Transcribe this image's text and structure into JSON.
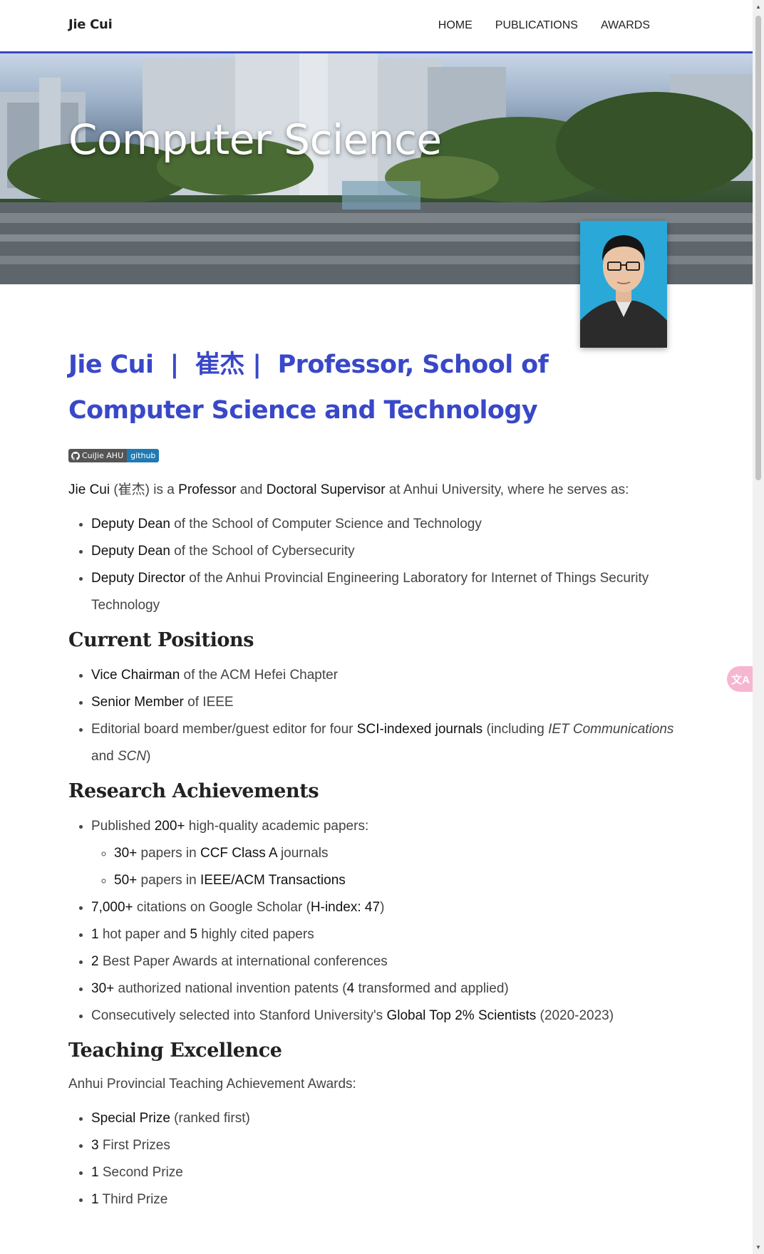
{
  "nav": {
    "brand": "Jie Cui",
    "items": [
      "HOME",
      "PUBLICATIONS",
      "AWARDS"
    ]
  },
  "hero": {
    "title": "Computer Science"
  },
  "profile": {
    "title": "Jie Cui  |  崔杰 |  Professor, School of Computer Science and Technology",
    "badge_left": "CuiJie AHU",
    "badge_right": "github"
  },
  "intro": {
    "name": "Jie Cui",
    "cn": "(崔杰)",
    "t1": " is a ",
    "role1": "Professor",
    "t2": " and ",
    "role2": "Doctoral Supervisor",
    "t3": " at Anhui University, where he serves as:"
  },
  "roles": [
    {
      "strong": "Deputy Dean",
      "rest": " of the School of Computer Science and Technology"
    },
    {
      "strong": "Deputy Dean",
      "rest": " of the School of Cybersecurity"
    },
    {
      "strong": "Deputy Director",
      "rest": " of the Anhui Provincial Engineering Laboratory for Internet of Things Security Technology"
    }
  ],
  "positions": {
    "heading": "Current Positions",
    "items": [
      {
        "strong": "Vice Chairman",
        "rest": " of the ACM Hefei Chapter"
      },
      {
        "strong": "Senior Member",
        "rest": " of IEEE"
      }
    ],
    "editorial": {
      "pre": "Editorial board member/guest editor for four ",
      "strong": "SCI-indexed journals",
      "mid": " (including ",
      "j1": "IET Communications",
      "and": " and ",
      "j2": "SCN",
      "end": ")"
    }
  },
  "research": {
    "heading": "Research Achievements",
    "papers": {
      "pre": "Published ",
      "strong": "200+",
      "rest": " high-quality academic papers:"
    },
    "sub": [
      {
        "num": "30+",
        "mid": " papers in ",
        "strong": "CCF Class A",
        "rest": " journals"
      },
      {
        "num": "50+",
        "mid": " papers in ",
        "strong": "IEEE/ACM Transactions",
        "rest": ""
      }
    ],
    "citations": {
      "num": "7,000+",
      "mid": " citations on Google Scholar (",
      "strong": "H-index: 47",
      "end": ")"
    },
    "hot": {
      "n1": "1",
      "t1": " hot paper and ",
      "n2": "5",
      "t2": " highly cited papers"
    },
    "best": {
      "n": "2",
      "t": " Best Paper Awards at international conferences"
    },
    "patents": {
      "n": "30+",
      "t1": " authorized national invention patents (",
      "n2": "4",
      "t2": " transformed and applied)"
    },
    "stanford": {
      "pre": "Consecutively selected into Stanford University's ",
      "strong": "Global Top 2% Scientists",
      "rest": " (2020-2023)"
    }
  },
  "teaching": {
    "heading": "Teaching Excellence",
    "intro": "Anhui Provincial Teaching Achievement Awards:",
    "items": [
      {
        "strong": "Special Prize",
        "rest": " (ranked first)"
      },
      {
        "strong": "3",
        "rest": " First Prizes"
      },
      {
        "strong": "1",
        "rest": " Second Prize"
      },
      {
        "strong": "1",
        "rest": " Third Prize"
      }
    ]
  },
  "widgets": {
    "translate_glyph": "文A"
  },
  "colors": {
    "accent": "#3948c8",
    "badge_blue": "#1f7ab3",
    "photo_bg": "#2aa8d8"
  },
  "icons": [
    "github-icon",
    "translate-icon",
    "scroll-up-icon",
    "scroll-down-icon"
  ]
}
